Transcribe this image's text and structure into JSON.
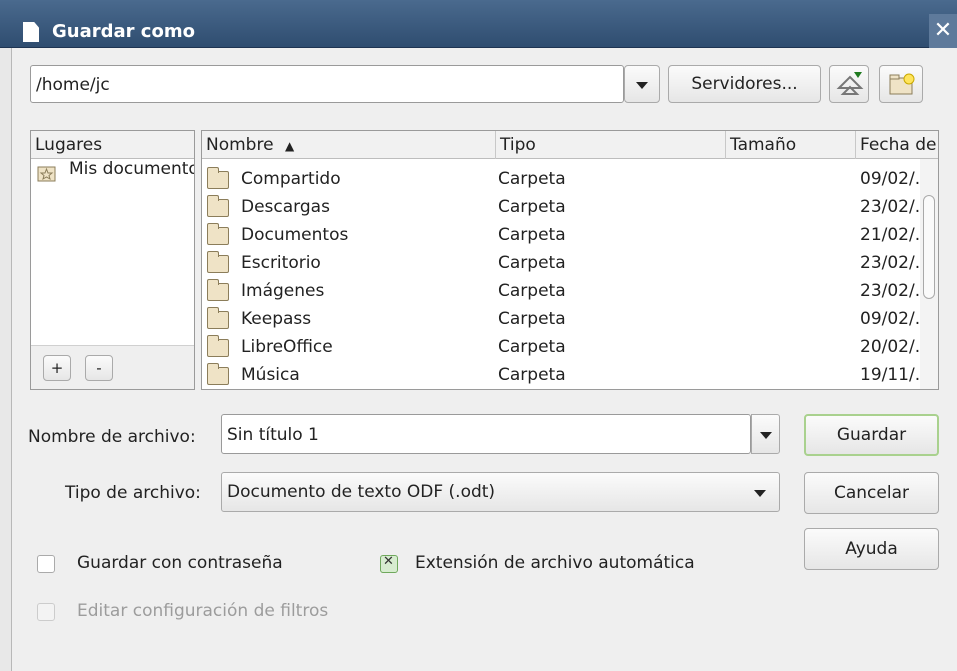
{
  "window": {
    "title": "Guardar como",
    "close": "✕"
  },
  "path": {
    "value": "/home/jc"
  },
  "toolbar": {
    "servers_label": "Servidores..."
  },
  "places": {
    "header": "Lugares",
    "items": [
      {
        "label": "Mis documentos"
      }
    ],
    "add_label": "+",
    "remove_label": "-"
  },
  "files": {
    "columns": [
      "Nombre",
      "Tipo",
      "Tamaño",
      "Fecha de"
    ],
    "sort_indicator": "▲",
    "rows": [
      {
        "name": "Compartido",
        "type": "Carpeta",
        "date": "09/02/."
      },
      {
        "name": "Descargas",
        "type": "Carpeta",
        "date": "23/02/."
      },
      {
        "name": "Documentos",
        "type": "Carpeta",
        "date": "21/02/."
      },
      {
        "name": "Escritorio",
        "type": "Carpeta",
        "date": "23/02/."
      },
      {
        "name": "Imágenes",
        "type": "Carpeta",
        "date": "23/02/."
      },
      {
        "name": "Keepass",
        "type": "Carpeta",
        "date": "09/02/."
      },
      {
        "name": "LibreOffice",
        "type": "Carpeta",
        "date": "20/02/."
      },
      {
        "name": "Música",
        "type": "Carpeta",
        "date": "19/11/."
      }
    ]
  },
  "filename": {
    "label": "Nombre de archivo:",
    "value": "Sin título 1"
  },
  "filetype": {
    "label": "Tipo de archivo:",
    "value": "Documento de texto ODF (.odt)"
  },
  "buttons": {
    "save": "Guardar",
    "cancel": "Cancelar",
    "help": "Ayuda"
  },
  "options": {
    "password": {
      "label": "Guardar con contraseña",
      "checked": false
    },
    "auto_ext": {
      "label": "Extensión de archivo automática",
      "checked": true
    },
    "filter_settings": {
      "label": "Editar configuración de filtros",
      "checked": false,
      "enabled": false
    }
  }
}
